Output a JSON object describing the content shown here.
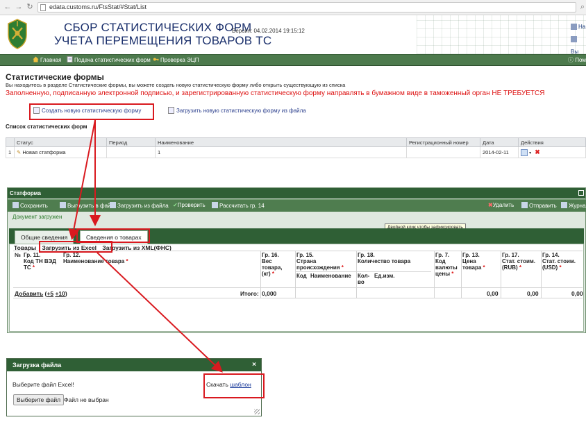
{
  "browser": {
    "url_proto": "",
    "url": "edata.customs.ru/FtsStat/#Stat/List"
  },
  "header": {
    "title_line1": "СБОР СТАТИСТИЧЕСКИХ ФОРМ",
    "title_line2": "УЧЕТА ПЕРЕМЕЩЕНИЯ ТОВАРОВ ТС",
    "version": "Версия: 04.02.2014 19:15:12",
    "links": [
      "На",
      "Вы"
    ]
  },
  "nav": {
    "home": "Главная",
    "submit": "Подача статистических форм",
    "verify": "Проверка ЭЦП",
    "help": "Пом"
  },
  "page": {
    "title": "Статистические формы",
    "description": "Вы находитесь в разделе Статистические формы, вы можете создать новую статистическую форму либо открыть существующую из списка",
    "warning": "Заполненную, подписанную электронной подписью, и зарегистрированную статистическую форму направлять в бумажном виде в таможенный орган НЕ ТРЕБУЕТСЯ",
    "create_label": "Создать новую статистическую форму",
    "upload_label": "Загрузить новую статистическую форму из файла",
    "list_title": "Список статистических форм"
  },
  "table": {
    "columns": [
      "",
      "Статус",
      "Период",
      "Наименование",
      "Регистрационный номер",
      "Дата",
      "Действия"
    ],
    "rows": [
      {
        "num": "1",
        "status": "Новая статформа",
        "period": "",
        "name": "1",
        "reg": "",
        "date": "2014-02-11"
      }
    ]
  },
  "statform": {
    "title": "Статформа",
    "toolbar": {
      "save": "Сохранить",
      "export": "Выгрузить в файл",
      "import": "Загрузить из файла",
      "check": "Проверить",
      "calc": "Рассчитать гр. 14",
      "delete": "Удалить",
      "send": "Отправить",
      "journal": "Журнал"
    },
    "status": "Документ загружен",
    "tooltip": "Двойной клик чтобы зафиксировать",
    "tabs": [
      "Общие сведения",
      "Сведения о товарах"
    ],
    "goods": {
      "label": "Товары",
      "load_excel": "Загрузить из Excel",
      "load_xml": "Загрузить из XML(ФНС)",
      "col_num": "№",
      "col_g11_a": "Гр. 11.",
      "col_g11_b": "Код ТН ВЭД",
      "col_g11_c": "ТС",
      "col_g12_a": "Гр. 12.",
      "col_g12_b": "Наименование товара",
      "col_g16_a": "Гр. 16.",
      "col_g16_b": "Вес",
      "col_g16_c": "товара,",
      "col_g16_d": "(кг)",
      "col_g15_a": "Гр. 15.",
      "col_g15_b": "Страна",
      "col_g15_c": "происхождения",
      "col_g15_kod": "Код",
      "col_g15_name": "Наименование",
      "col_g18_a": "Гр. 18.",
      "col_g18_b": "Количество товара",
      "col_g18_qty_a": "Кол-",
      "col_g18_qty_b": "во",
      "col_g18_unit": "Ед.изм.",
      "col_g7_a": "Гр. 7.",
      "col_g7_b": "Код",
      "col_g7_c": "валюты",
      "col_g7_d": "цены",
      "col_g13_a": "Гр. 13.",
      "col_g13_b": "Цена",
      "col_g13_c": "товара",
      "col_g17_a": "Гр. 17.",
      "col_g17_b": "Стат. стоим.",
      "col_g17_c": "(RUB)",
      "col_g14_a": "Гр. 14.",
      "col_g14_b": "Стат. стоим.",
      "col_g14_c": "(USD)",
      "add": "Добавить",
      "add5": "+5",
      "add10": "+10",
      "itogo_label": "Итого:",
      "itogo_weight": "0,000",
      "total_price": "0,00",
      "total_rub": "0,00",
      "total_usd": "0,00"
    }
  },
  "upload_dialog": {
    "title": "Загрузка файла",
    "close": "×",
    "select_label": "Выберите файл Excel!",
    "download_prefix": "Скачать",
    "download_link": "шаблон",
    "file_button": "Выберите файл",
    "no_file": "Файл не выбран"
  },
  "colors": {
    "nav_green": "#4d7a4d",
    "dark_green": "#2f5f35",
    "warning_red": "#dd1111",
    "annotation_red": "#d9191f",
    "title_blue": "#1a2f6b"
  }
}
